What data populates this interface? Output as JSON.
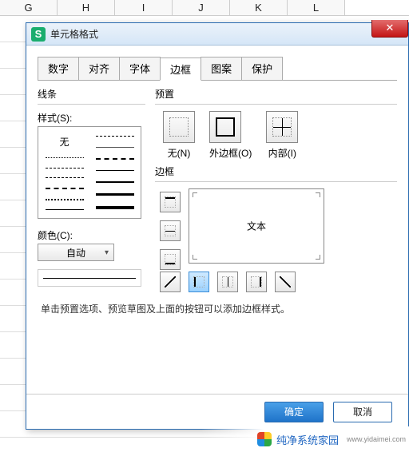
{
  "columns": [
    "G",
    "H",
    "I",
    "J",
    "K",
    "L"
  ],
  "dialog": {
    "title": "单元格格式",
    "close": "✕",
    "tabs": [
      "数字",
      "对齐",
      "字体",
      "边框",
      "图案",
      "保护"
    ],
    "active_tab_index": 3,
    "line_section": "线条",
    "style_label": "样式(S):",
    "style_none": "无",
    "color_label": "颜色(C):",
    "color_value": "自动",
    "preset_section": "预置",
    "presets": {
      "none": "无(N)",
      "outer": "外边框(O)",
      "inner": "内部(I)"
    },
    "border_section": "边框",
    "preview_text": "文本",
    "hint": "单击预置选项、预览草图及上面的按钮可以添加边框样式。",
    "ok": "确定",
    "cancel": "取消"
  },
  "watermark": {
    "brand": "纯净系统家园",
    "url": "www.yidaimei.com"
  }
}
